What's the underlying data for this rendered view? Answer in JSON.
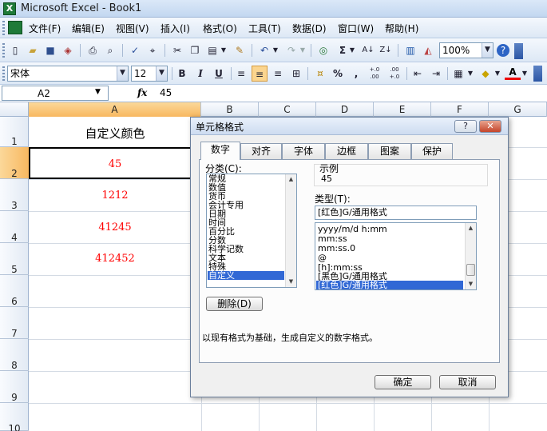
{
  "window": {
    "title": "Microsoft Excel - Book1",
    "app_icon": "X"
  },
  "menu": [
    "文件(F)",
    "编辑(E)",
    "视图(V)",
    "插入(I)",
    "格式(O)",
    "工具(T)",
    "数据(D)",
    "窗口(W)",
    "帮助(H)"
  ],
  "toolbar": {
    "zoom": "100%",
    "font_name": "宋体",
    "font_size": "12",
    "bold": "B",
    "italic": "I",
    "underline": "U",
    "percent": "%",
    "comma": ",",
    "inc_decimal": "+.0 .00",
    "dec_decimal": ".00 +.0"
  },
  "formula_bar": {
    "name_box": "A2",
    "fx": "fx",
    "formula": "45"
  },
  "columns": [
    "A",
    "B",
    "C",
    "D",
    "E",
    "F",
    "G"
  ],
  "rows": [
    "1",
    "2",
    "3",
    "4",
    "5",
    "6",
    "7",
    "8",
    "9",
    "10"
  ],
  "cells": {
    "A1": "自定义颜色",
    "A2": "45",
    "A3": "1212",
    "A4": "41245",
    "A5": "412452"
  },
  "colors": {
    "cell_text_red": "#ff0000",
    "selection_header": "#f8b860",
    "list_highlight": "#3168d5"
  },
  "dialog": {
    "title": "单元格格式",
    "help": "?",
    "close": "✕",
    "tabs": [
      "数字",
      "对齐",
      "字体",
      "边框",
      "图案",
      "保护"
    ],
    "category_label": "分类(C):",
    "categories": [
      "常规",
      "数值",
      "货币",
      "会计专用",
      "日期",
      "时间",
      "百分比",
      "分数",
      "科学记数",
      "文本",
      "特殊",
      "自定义"
    ],
    "sample_label": "示例",
    "sample_value": "45",
    "type_label": "类型(T):",
    "type_value": "[红色]G/通用格式",
    "type_list": [
      "yyyy/m/d h:mm",
      "mm:ss",
      "mm:ss.0",
      "@",
      "[h]:mm:ss",
      "[黑色]G/通用格式",
      "[红色]G/通用格式"
    ],
    "delete_button": "删除(D)",
    "description": "以现有格式为基础，生成自定义的数字格式。",
    "ok_button": "确定",
    "cancel_button": "取消"
  }
}
